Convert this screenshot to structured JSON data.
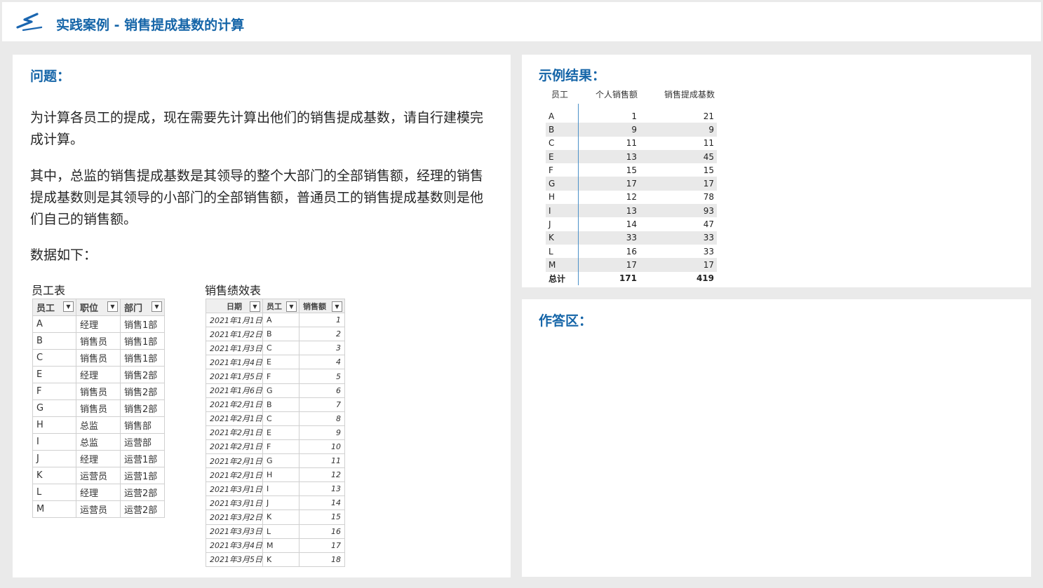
{
  "header": {
    "title": "实践案例 - 销售提成基数的计算"
  },
  "question": {
    "heading": "问题：",
    "para1": "为计算各员工的提成，现在需要先计算出他们的销售提成基数，请自行建模完成计算。",
    "para2": "其中，总监的销售提成基数是其领导的整个大部门的全部销售额，经理的销售提成基数则是其领导的小部门的全部销售额，普通员工的销售提成基数则是他们自己的销售额。",
    "para3": "数据如下："
  },
  "employee_table": {
    "caption": "员工表",
    "columns": [
      "员工",
      "职位",
      "部门"
    ],
    "rows": [
      [
        "A",
        "经理",
        "销售1部"
      ],
      [
        "B",
        "销售员",
        "销售1部"
      ],
      [
        "C",
        "销售员",
        "销售1部"
      ],
      [
        "E",
        "经理",
        "销售2部"
      ],
      [
        "F",
        "销售员",
        "销售2部"
      ],
      [
        "G",
        "销售员",
        "销售2部"
      ],
      [
        "H",
        "总监",
        "销售部"
      ],
      [
        "I",
        "总监",
        "运营部"
      ],
      [
        "J",
        "经理",
        "运营1部"
      ],
      [
        "K",
        "运营员",
        "运营1部"
      ],
      [
        "L",
        "经理",
        "运营2部"
      ],
      [
        "M",
        "运营员",
        "运营2部"
      ]
    ]
  },
  "sales_table": {
    "caption": "销售绩效表",
    "columns": [
      "日期",
      "员工",
      "销售额"
    ],
    "rows": [
      [
        "2021年1月1日",
        "A",
        "1"
      ],
      [
        "2021年1月2日",
        "B",
        "2"
      ],
      [
        "2021年1月3日",
        "C",
        "3"
      ],
      [
        "2021年1月4日",
        "E",
        "4"
      ],
      [
        "2021年1月5日",
        "F",
        "5"
      ],
      [
        "2021年1月6日",
        "G",
        "6"
      ],
      [
        "2021年2月1日",
        "B",
        "7"
      ],
      [
        "2021年2月1日",
        "C",
        "8"
      ],
      [
        "2021年2月1日",
        "E",
        "9"
      ],
      [
        "2021年2月1日",
        "F",
        "10"
      ],
      [
        "2021年2月1日",
        "G",
        "11"
      ],
      [
        "2021年2月1日",
        "H",
        "12"
      ],
      [
        "2021年3月1日",
        "I",
        "13"
      ],
      [
        "2021年3月1日",
        "J",
        "14"
      ],
      [
        "2021年3月2日",
        "K",
        "15"
      ],
      [
        "2021年3月3日",
        "L",
        "16"
      ],
      [
        "2021年3月4日",
        "M",
        "17"
      ],
      [
        "2021年3月5日",
        "K",
        "18"
      ]
    ]
  },
  "example": {
    "heading": "示例结果：",
    "columns": [
      "员工",
      "个人销售额",
      "销售提成基数"
    ],
    "rows": [
      [
        "A",
        "1",
        "21"
      ],
      [
        "B",
        "9",
        "9"
      ],
      [
        "C",
        "11",
        "11"
      ],
      [
        "E",
        "13",
        "45"
      ],
      [
        "F",
        "15",
        "15"
      ],
      [
        "G",
        "17",
        "17"
      ],
      [
        "H",
        "12",
        "78"
      ],
      [
        "I",
        "13",
        "93"
      ],
      [
        "J",
        "14",
        "47"
      ],
      [
        "K",
        "33",
        "33"
      ],
      [
        "L",
        "16",
        "33"
      ],
      [
        "M",
        "17",
        "17"
      ]
    ],
    "total": [
      "总计",
      "171",
      "419"
    ]
  },
  "answer": {
    "heading": "作答区："
  },
  "colors": {
    "accent": "#1565a8",
    "panel": "#ffffff",
    "background": "#eaeaea"
  },
  "icons": {
    "logo": "stylized-s-lightning-logo",
    "filter": "dropdown-filter-icon"
  }
}
